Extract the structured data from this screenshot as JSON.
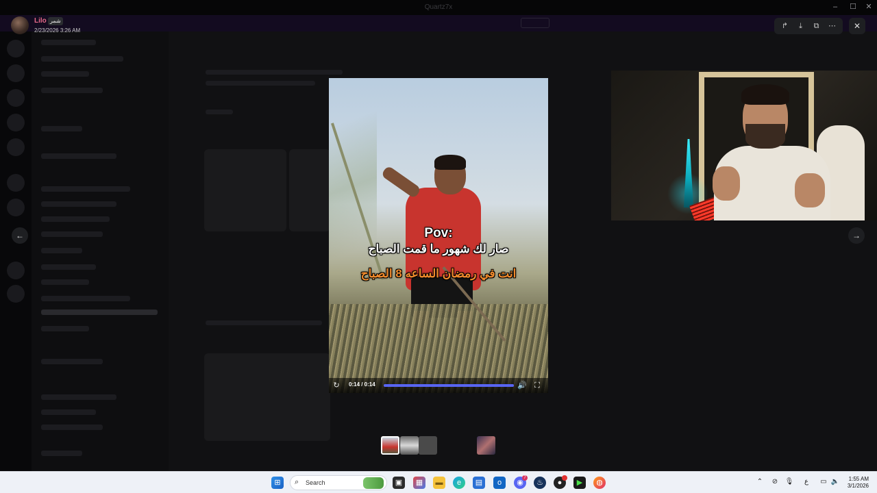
{
  "window": {
    "title": "Quartz7x"
  },
  "lightbox": {
    "user": {
      "name": "Lilo",
      "tag": "شمر",
      "timestamp": "2/23/2026 3:26 AM"
    },
    "tools": {
      "share_icon": "forward-icon",
      "download_icon": "download-icon",
      "open_icon": "open-external-icon",
      "more_icon": "more-icon",
      "close_icon": "close-icon"
    },
    "video": {
      "caption_pov": "Pov:",
      "caption_line1": "صار لك شهور ما قمت الصباح",
      "caption_line2": "انت في رمضان الساعه 8 الصباح",
      "time": "0:14 / 0:14",
      "progress_fraction": 1.0
    },
    "thumbnail_count": 4
  },
  "taskbar": {
    "search_placeholder": "Search",
    "clock_time": "1:55 AM",
    "clock_date": "3/1/2026",
    "tray_lang": "ع",
    "badges": {
      "discord": "7"
    }
  },
  "colors": {
    "accent": "#5865f2",
    "username": "#e86a8a",
    "caption_highlight": "#f08a2c"
  }
}
